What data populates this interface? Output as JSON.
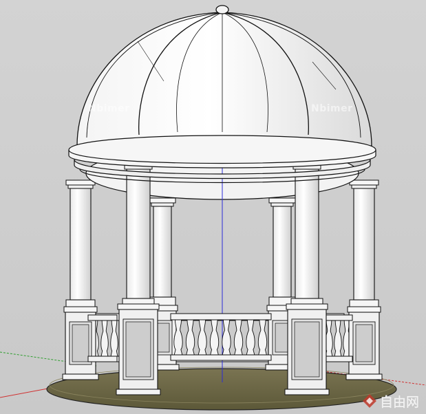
{
  "scene": {
    "colors": {
      "background": "#cfcfcf",
      "stone": "#f2f2f2",
      "outline": "#111111",
      "floor": "#6f6a48",
      "axis_red": "#d03030",
      "axis_green": "#2e9e2e",
      "axis_blue": "#2b2bd8"
    }
  },
  "watermarks": {
    "left": "Nbimer",
    "right": "Nbimer"
  },
  "brand": {
    "icon": "diamond-logo-icon",
    "text": "自由网",
    "color": "#c0392b"
  }
}
